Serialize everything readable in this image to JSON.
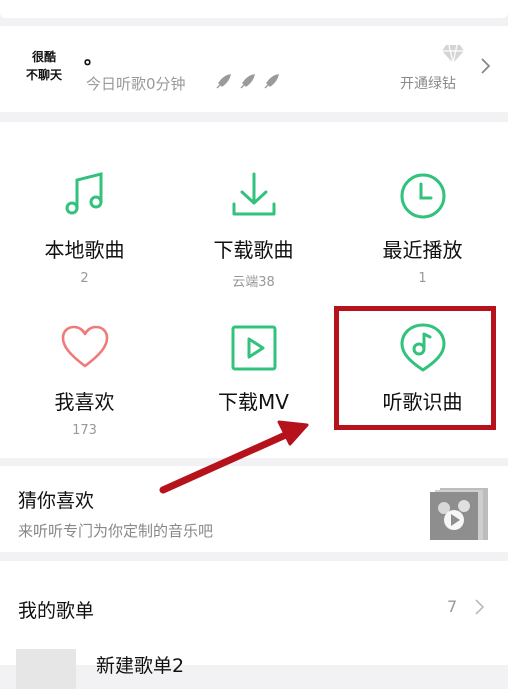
{
  "user": {
    "logo_line1": "很酷",
    "logo_line2": "不聊天",
    "nickname": "。",
    "listen_today": "今日听歌0分钟",
    "vip_label": "开通绿钻"
  },
  "grid": [
    {
      "label": "本地歌曲",
      "sub": "2",
      "icon": "music-note-icon"
    },
    {
      "label": "下载歌曲",
      "sub": "云端38",
      "icon": "download-icon"
    },
    {
      "label": "最近播放",
      "sub": "1",
      "icon": "clock-icon"
    },
    {
      "label": "我喜欢",
      "sub": "173",
      "icon": "heart-icon"
    },
    {
      "label": "下载MV",
      "sub": "",
      "icon": "play-box-icon"
    },
    {
      "label": "听歌识曲",
      "sub": "",
      "icon": "recognize-song-icon"
    }
  ],
  "recommend": {
    "title": "猜你喜欢",
    "subtitle": "来听听专门为你定制的音乐吧"
  },
  "playlists": {
    "title": "我的歌单",
    "count": "7",
    "first_item": "新建歌单2"
  },
  "colors": {
    "accent_green": "#31c27c",
    "heart_pink": "#f07a7a",
    "annotation_red": "#b5121c"
  }
}
